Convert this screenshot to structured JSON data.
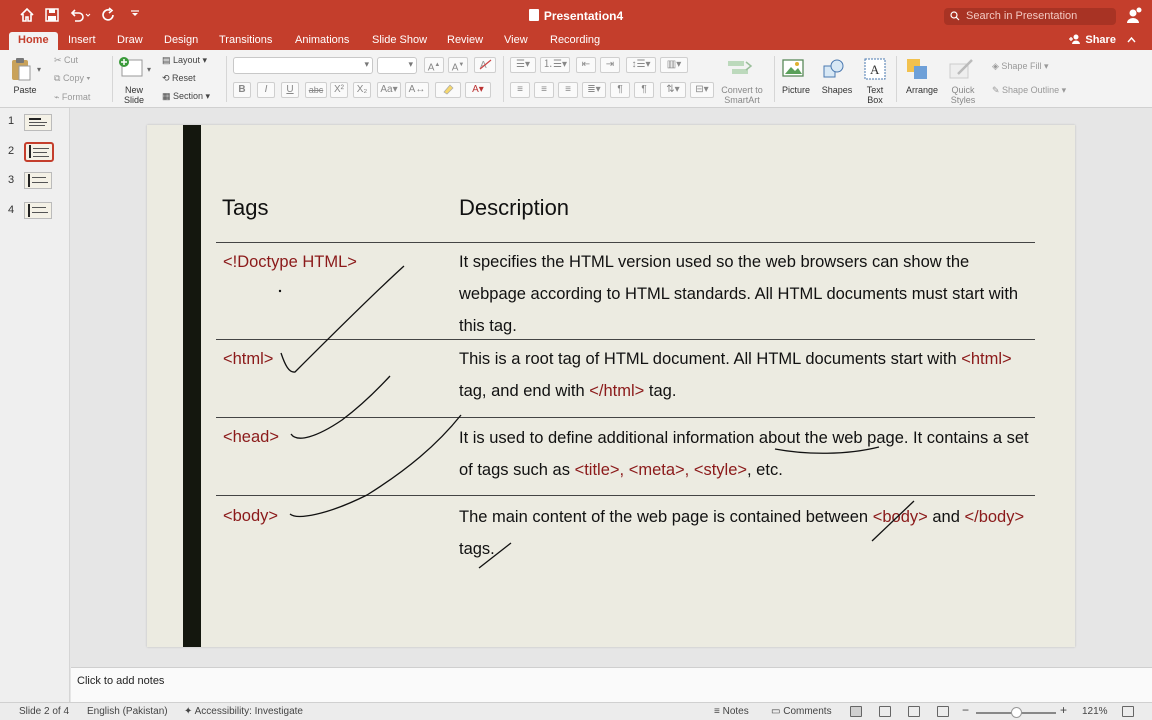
{
  "titlebar": {
    "doc_title": "Presentation4",
    "search_placeholder": "Search in Presentation",
    "icons": [
      "home-icon",
      "save-icon",
      "undo-icon",
      "redo-icon",
      "customize-icon",
      "user-icon"
    ]
  },
  "tabs": [
    "Home",
    "Insert",
    "Draw",
    "Design",
    "Transitions",
    "Animations",
    "Slide Show",
    "Review",
    "View",
    "Recording"
  ],
  "share_label": "Share",
  "ribbon": {
    "paste": "Paste",
    "cut": "Cut",
    "copy": "Copy",
    "format": "Format",
    "new_slide": "New\nSlide",
    "layout": "Layout",
    "reset": "Reset",
    "section": "Section",
    "convert_smartart": "Convert to SmartArt",
    "picture": "Picture",
    "shapes": "Shapes",
    "text_box": "Text Box",
    "arrange": "Arrange",
    "quick_styles": "Quick Styles",
    "shape_fill": "Shape Fill",
    "shape_outline": "Shape Outline",
    "font_buttons": [
      "B",
      "I",
      "U",
      "abc",
      "X²",
      "X₂"
    ]
  },
  "thumbnails": [
    "1",
    "2",
    "3",
    "4"
  ],
  "slide": {
    "col_tags": "Tags",
    "col_desc": "Description",
    "rows": [
      {
        "tag": "<!Doctype HTML>",
        "desc": [
          {
            "t": "It specifies the HTML version used so the web browsers can show the webpage according to HTML standards. All HTML documents must start with this tag.",
            "red": false
          }
        ]
      },
      {
        "tag": "<html>",
        "desc": [
          {
            "t": "This is a root tag of HTML document. All HTML documents start with ",
            "red": false
          },
          {
            "t": "<html>",
            "red": true
          },
          {
            "t": " tag, and end with ",
            "red": false
          },
          {
            "t": "</html>",
            "red": true
          },
          {
            "t": " tag.",
            "red": false
          }
        ]
      },
      {
        "tag": "<head>",
        "desc": [
          {
            "t": "It is used to define additional information about the web page. It contains a set of tags such as ",
            "red": false
          },
          {
            "t": "<title>, <meta>, <style>",
            "red": true
          },
          {
            "t": ", etc.",
            "red": false
          }
        ]
      },
      {
        "tag": "<body>",
        "desc": [
          {
            "t": "The main content of the web page is contained between ",
            "red": false
          },
          {
            "t": "<body>",
            "red": true
          },
          {
            "t": " and ",
            "red": false
          },
          {
            "t": "</body>",
            "red": true
          },
          {
            "t": " tags.",
            "red": false
          }
        ]
      }
    ]
  },
  "notes_placeholder": "Click to add notes",
  "status": {
    "slide_counter": "Slide 2 of 4",
    "language": "English (Pakistan)",
    "accessibility": "Accessibility: Investigate",
    "notes": "Notes",
    "comments": "Comments",
    "zoom": "121%"
  },
  "colors": {
    "accent": "#c43e2c",
    "slide_bg": "#ecebe1",
    "tag_red": "#8b1a1a",
    "slide_bar": "#14170e"
  }
}
